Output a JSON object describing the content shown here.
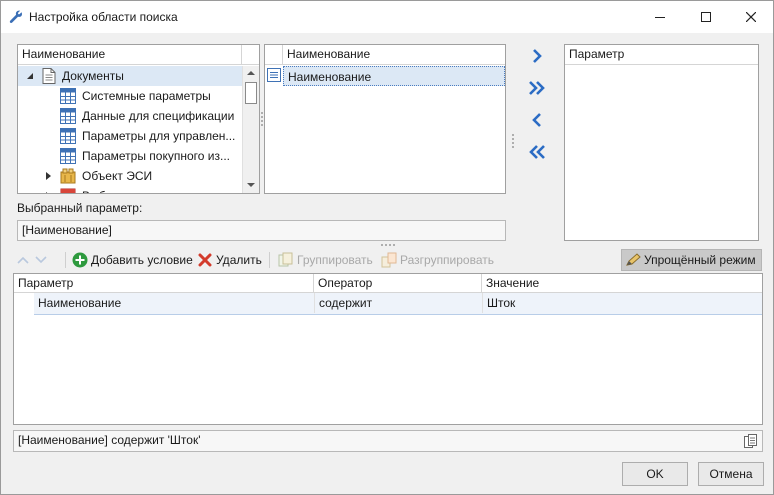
{
  "window": {
    "title": "Настройка области поиска",
    "minimize_icon": "minimize-icon",
    "maximize_icon": "maximize-icon",
    "close_icon": "close-icon"
  },
  "tree_panel": {
    "header": "Наименование",
    "items": [
      {
        "label": "Документы",
        "icon": "document-icon",
        "expanded": true
      },
      {
        "label": "Системные параметры",
        "icon": "table-icon"
      },
      {
        "label": "Данные для спецификации",
        "icon": "table-icon"
      },
      {
        "label": "Параметры для управлен...",
        "icon": "table-icon"
      },
      {
        "label": "Параметры покупного из...",
        "icon": "table-icon"
      },
      {
        "label": "Объект ЭСИ",
        "icon": "assembly-icon",
        "expanded": false
      },
      {
        "label": "Выб...",
        "icon": "assembly-icon",
        "expanded": false
      }
    ]
  },
  "fields_panel": {
    "header": "Наименование",
    "items": [
      "Наименование"
    ]
  },
  "result_panel": {
    "header": "Параметр"
  },
  "move_buttons": [
    "move-right-icon",
    "move-all-right-icon",
    "move-left-icon",
    "move-all-left-icon"
  ],
  "selected_param": {
    "label": "Выбранный параметр:",
    "value": "[Наименование]"
  },
  "toolbar": {
    "add_condition": "Добавить условие",
    "delete": "Удалить",
    "group": "Группировать",
    "ungroup": "Разгруппировать",
    "simple_mode": "Упрощённый режим"
  },
  "conditions_grid": {
    "columns": [
      "Параметр",
      "Оператор",
      "Значение"
    ],
    "rows": [
      {
        "param": "Наименование",
        "operator": "содержит",
        "value": "Шток"
      }
    ]
  },
  "expression": "[Наименование] содержит 'Шток'",
  "buttons": {
    "ok": "OK",
    "cancel": "Отмена"
  },
  "colors": {
    "accent": "#2b6cc4",
    "selected_row": "#dce8f5",
    "add_green": "#2e9a3e",
    "delete_red": "#d33b2c"
  }
}
